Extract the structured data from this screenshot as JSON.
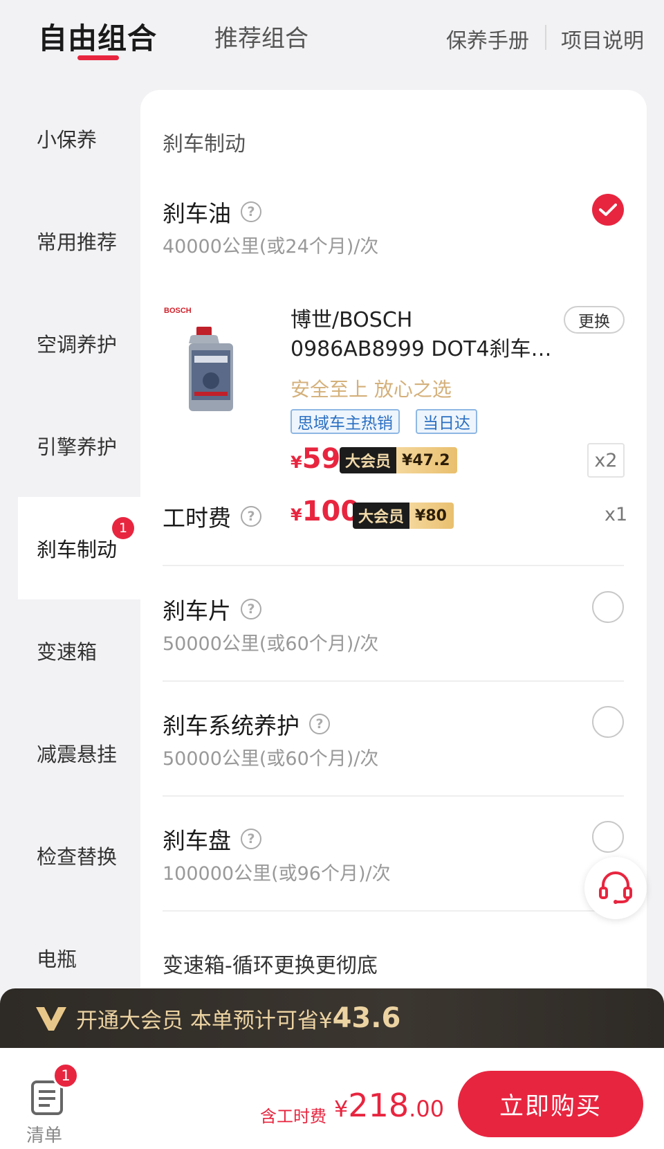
{
  "header": {
    "tabs": [
      {
        "label": "自由组合",
        "active": true
      },
      {
        "label": "推荐组合",
        "active": false
      }
    ],
    "links": [
      "保养手册",
      "项目说明"
    ]
  },
  "sidebar": {
    "items": [
      {
        "label": "小保养"
      },
      {
        "label": "常用推荐"
      },
      {
        "label": "空调养护"
      },
      {
        "label": "引擎养护"
      },
      {
        "label": "刹车制动",
        "active": true,
        "badge": "1"
      },
      {
        "label": "变速箱"
      },
      {
        "label": "减震悬挂"
      },
      {
        "label": "检查替换"
      },
      {
        "label": "电瓶"
      }
    ]
  },
  "section": {
    "title": "刹车制动",
    "items": [
      {
        "name": "刹车油",
        "interval": "40000公里(或24个月)/次",
        "checked": true
      },
      {
        "name": "刹车片",
        "interval": "50000公里(或60个月)/次",
        "checked": false
      },
      {
        "name": "刹车系统养护",
        "interval": "50000公里(或60个月)/次",
        "checked": false
      },
      {
        "name": "刹车盘",
        "interval": "100000公里(或96个月)/次",
        "checked": false
      }
    ],
    "next_section": "变速箱-循环更换更彻底"
  },
  "product": {
    "brand_logo": "BOSCH",
    "name_line1": "博世/BOSCH",
    "name_line2": "0986AB8999 DOT4刹车…",
    "swap_label": "更换",
    "slogan": "安全至上 放心之选",
    "tags": [
      "思域车主热销",
      "当日达"
    ],
    "price_currency": "¥",
    "price": "59",
    "vip_label": "大会员",
    "vip_price": "¥47.2",
    "quantity": "x2"
  },
  "labor": {
    "name": "工时费",
    "price_currency": "¥",
    "price": "100",
    "vip_label": "大会员",
    "vip_price": "¥80",
    "quantity": "x1"
  },
  "vip_bar": {
    "text": "开通大会员 本单预计可省¥",
    "amount": "43.6"
  },
  "footer": {
    "list_label": "清单",
    "list_badge": "1",
    "total_label": "含工时费",
    "total_currency": "¥",
    "total_int": "218",
    "total_dec": ".00",
    "buy_label": "立即购买"
  },
  "colors": {
    "accent": "#e8253f",
    "gold": "#d4b07a",
    "vip_dark": "#1c1c1c",
    "tag_blue": "#2a6fc2"
  },
  "icons": [
    "question-icon",
    "check-icon",
    "support-headset-icon",
    "list-icon",
    "vip-crown-icon"
  ]
}
